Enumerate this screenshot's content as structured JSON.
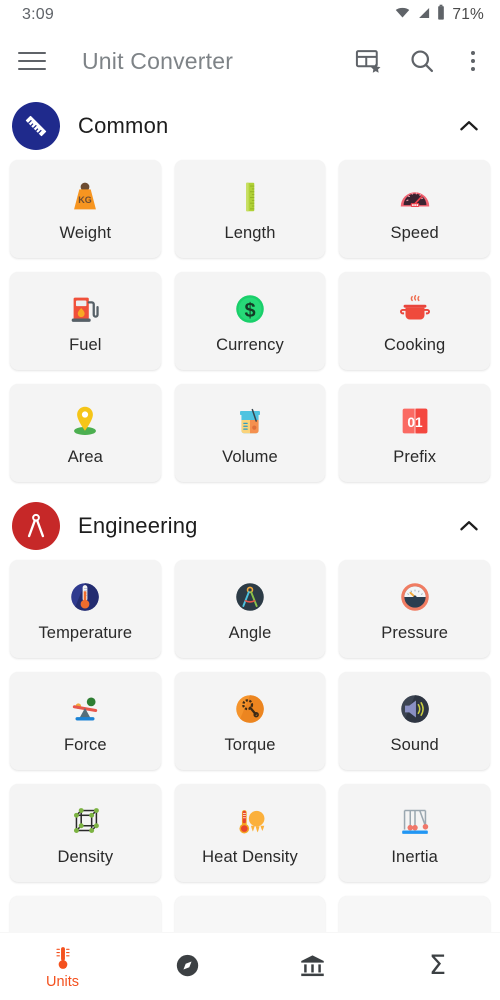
{
  "status_bar": {
    "time": "3:09",
    "battery_percent": "71%",
    "icons": [
      "wifi-icon",
      "cellular-signal-icon",
      "battery-icon"
    ]
  },
  "toolbar": {
    "menu_icon": "hamburger-menu-icon",
    "title": "Unit Converter",
    "actions": [
      {
        "name": "favorites-grid-icon",
        "label": "Favorites"
      },
      {
        "name": "search-icon",
        "label": "Search"
      },
      {
        "name": "overflow-menu-icon",
        "label": "More options"
      }
    ]
  },
  "sections": [
    {
      "id": "common",
      "title": "Common",
      "icon": "ruler-icon",
      "circle_color": "#1f2a8c",
      "expanded": true,
      "chevron": "chevron-up-icon",
      "tiles": [
        {
          "label": "Weight",
          "icon": "weight-kg-icon"
        },
        {
          "label": "Length",
          "icon": "ruler-vertical-icon"
        },
        {
          "label": "Speed",
          "icon": "speedometer-icon"
        },
        {
          "label": "Fuel",
          "icon": "fuel-pump-icon"
        },
        {
          "label": "Currency",
          "icon": "dollar-coin-icon"
        },
        {
          "label": "Cooking",
          "icon": "cooking-pot-icon"
        },
        {
          "label": "Area",
          "icon": "map-pin-icon"
        },
        {
          "label": "Volume",
          "icon": "beaker-icon"
        },
        {
          "label": "Prefix",
          "icon": "zero-one-icon"
        }
      ]
    },
    {
      "id": "engineering",
      "title": "Engineering",
      "icon": "compass-divider-icon",
      "circle_color": "#c62828",
      "expanded": true,
      "chevron": "chevron-up-icon",
      "tiles": [
        {
          "label": "Temperature",
          "icon": "thermometer-icon"
        },
        {
          "label": "Angle",
          "icon": "protractor-compass-icon"
        },
        {
          "label": "Pressure",
          "icon": "pressure-gauge-icon"
        },
        {
          "label": "Force",
          "icon": "seesaw-balance-icon"
        },
        {
          "label": "Torque",
          "icon": "wrench-gear-icon"
        },
        {
          "label": "Sound",
          "icon": "speaker-volume-icon"
        },
        {
          "label": "Density",
          "icon": "lattice-cube-icon"
        },
        {
          "label": "Heat Density",
          "icon": "thermometer-sun-icon"
        },
        {
          "label": "Inertia",
          "icon": "newtons-cradle-icon"
        }
      ]
    }
  ],
  "bottom_nav": {
    "active_index": 0,
    "active_color": "#f4511e",
    "items": [
      {
        "label": "Units",
        "icon": "thermometer-units-icon",
        "active": true
      },
      {
        "label": "",
        "icon": "compass-explore-icon",
        "active": false
      },
      {
        "label": "",
        "icon": "bank-institution-icon",
        "active": false
      },
      {
        "label": "",
        "icon": "sigma-icon",
        "active": false
      }
    ]
  }
}
